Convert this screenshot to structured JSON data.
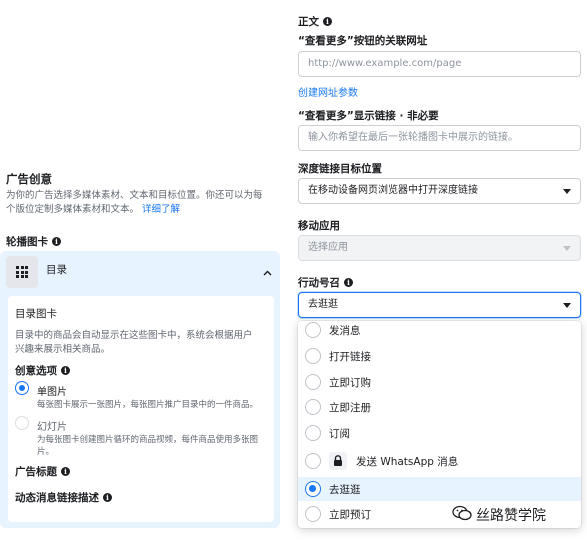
{
  "left": {
    "section_title": "广告创意",
    "section_desc_line1": "为你的广告选择多媒体素材、文本和目标位置。你还可以为每",
    "section_desc_line2": "个版位定制多媒体素材和文本。",
    "learn_more": "详细了解",
    "carousel_label": "轮播图卡",
    "catalog_label": "目录",
    "catalog_card_title": "目录图卡",
    "catalog_card_desc_line1": "目录中的商品会自动显示在这些图卡中，系统会根据用户",
    "catalog_card_desc_line2": "兴趣来展示相关商品。",
    "creative_options_label": "创意选项",
    "option_single": {
      "title": "单图片",
      "desc": "每张图卡展示一张图片，每张图片推广目录中的一件商品。"
    },
    "option_slideshow": {
      "title": "幻灯片",
      "desc_line1": "为每张图卡创建图片循环的商品视频，每件商品使用多张图",
      "desc_line2": "片。"
    },
    "headline_label": "广告标题",
    "dynamic_link_desc_label": "动态消息链接描述"
  },
  "right": {
    "body_label": "正文",
    "see_more_url_label": "“查看更多”按钮的关联网址",
    "see_more_url_placeholder": "http://www.example.com/page",
    "create_url_params": "创建网址参数",
    "see_more_display_label": "“查看更多”显示链接 · 非必要",
    "see_more_display_placeholder": "输入你希望在最后一张轮播图卡中展示的链接。",
    "deeplink_label": "深度链接目标位置",
    "deeplink_value": "在移动设备网页浏览器中打开深度链接",
    "mobile_app_label": "移动应用",
    "mobile_app_placeholder": "选择应用",
    "cta_label": "行动号召",
    "cta_value": "去逛逛"
  },
  "dropdown": {
    "options": [
      "发消息",
      "打开链接",
      "立即订购",
      "立即注册",
      "订阅",
      "发送 WhatsApp 消息",
      "去逛逛",
      "立即预订"
    ],
    "selected_index": 6
  },
  "watermark": "丝路赞学院",
  "colors": {
    "accent": "#1877f2",
    "card_bg": "#e7f3ff"
  }
}
